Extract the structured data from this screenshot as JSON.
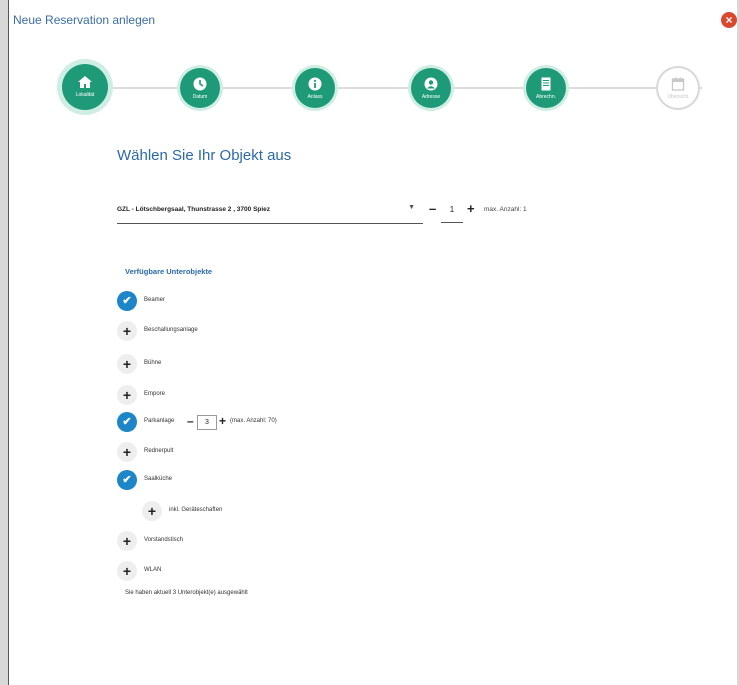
{
  "dialog": {
    "title": "Neue Reservation anlegen",
    "close_icon": "close-icon"
  },
  "steps": [
    {
      "label": "Lokalität",
      "icon": "home-icon",
      "state": "active"
    },
    {
      "label": "Datum",
      "icon": "clock-icon",
      "state": "done"
    },
    {
      "label": "Anlass",
      "icon": "info-icon",
      "state": "done"
    },
    {
      "label": "Adresse",
      "icon": "user-icon",
      "state": "done"
    },
    {
      "label": "Abrechn.",
      "icon": "document-icon",
      "state": "done"
    },
    {
      "label": "Übersicht",
      "icon": "calendar-icon",
      "state": "inactive"
    }
  ],
  "heading": "Wählen Sie Ihr Objekt aus",
  "object_select": {
    "value": "GZL - Lötschbergsaal, Thunstrasse 2 , 3700 Spiez"
  },
  "quantity": {
    "value": "1",
    "max_label": "max. Anzahl: 1"
  },
  "sub_heading": "Verfügbare Unterobjekte",
  "sub_objects": [
    {
      "label": "Beamer",
      "checked": true
    },
    {
      "label": "Beschallungsanlage",
      "checked": false
    },
    {
      "label": "Bühne",
      "checked": false
    },
    {
      "label": "Empore",
      "checked": false
    },
    {
      "label": "Parkanlage",
      "checked": true,
      "qty": "3",
      "max_label": "(max. Anzahl: 70)"
    },
    {
      "label": "Rednerpult",
      "checked": false
    },
    {
      "label": "Saalküche",
      "checked": true
    },
    {
      "label": "inkl. Geräteschaften",
      "checked": false,
      "nested": true
    },
    {
      "label": "Vorstandstisch",
      "checked": false
    },
    {
      "label": "WLAN",
      "checked": false
    }
  ],
  "summary": "Sie haben aktuell 3 Unterobjekt(e) ausgewählt",
  "colors": {
    "accent_green": "#1e9a78",
    "accent_blue": "#1c86c8",
    "title_blue": "#2a6aa8",
    "close_red": "#d9472f"
  }
}
